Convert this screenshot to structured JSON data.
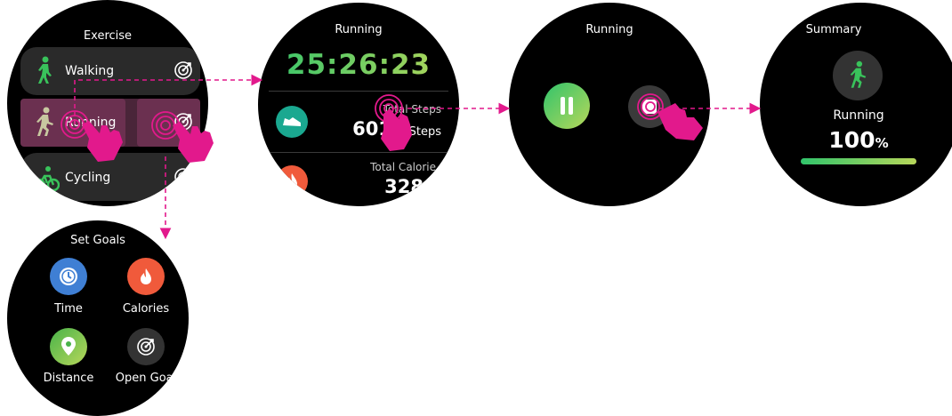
{
  "colors": {
    "accent_pink": "#e2198c",
    "green_grad_start": "#31c46b",
    "green_grad_end": "#b7d75a",
    "time_blue": "#3f7fd4",
    "calorie_orange": "#f05a3b",
    "distance_green": "#49b34a",
    "steps_teal": "#1aa890"
  },
  "exercise_screen": {
    "title": "Exercise",
    "items": [
      {
        "label": "Walking",
        "icon": "walking-icon",
        "goal_icon": "target-icon"
      },
      {
        "label": "Running",
        "icon": "running-icon",
        "goal_icon": "target-icon"
      },
      {
        "label": "Cycling",
        "icon": "cycling-icon",
        "goal_icon": "target-icon"
      }
    ]
  },
  "running_screen": {
    "title": "Running",
    "timer": "25:26:23",
    "steps_label": "Total Steps",
    "steps_value": "6011",
    "steps_unit": "Steps",
    "calories_label": "Total Calorie",
    "calories_value": "328"
  },
  "pause_screen": {
    "title": "Running",
    "pause_icon": "pause-icon",
    "stop_icon": "stop-icon"
  },
  "summary_screen": {
    "title": "Summary",
    "activity": "Running",
    "percent_number": "100",
    "percent_sign": "%",
    "progress": 1.0
  },
  "goals_screen": {
    "title": "Set Goals",
    "options": [
      {
        "label": "Time",
        "icon": "clock-icon"
      },
      {
        "label": "Calories",
        "icon": "flame-icon"
      },
      {
        "label": "Distance",
        "icon": "map-pin-icon"
      },
      {
        "label": "Open Goal",
        "icon": "target-icon"
      }
    ]
  }
}
